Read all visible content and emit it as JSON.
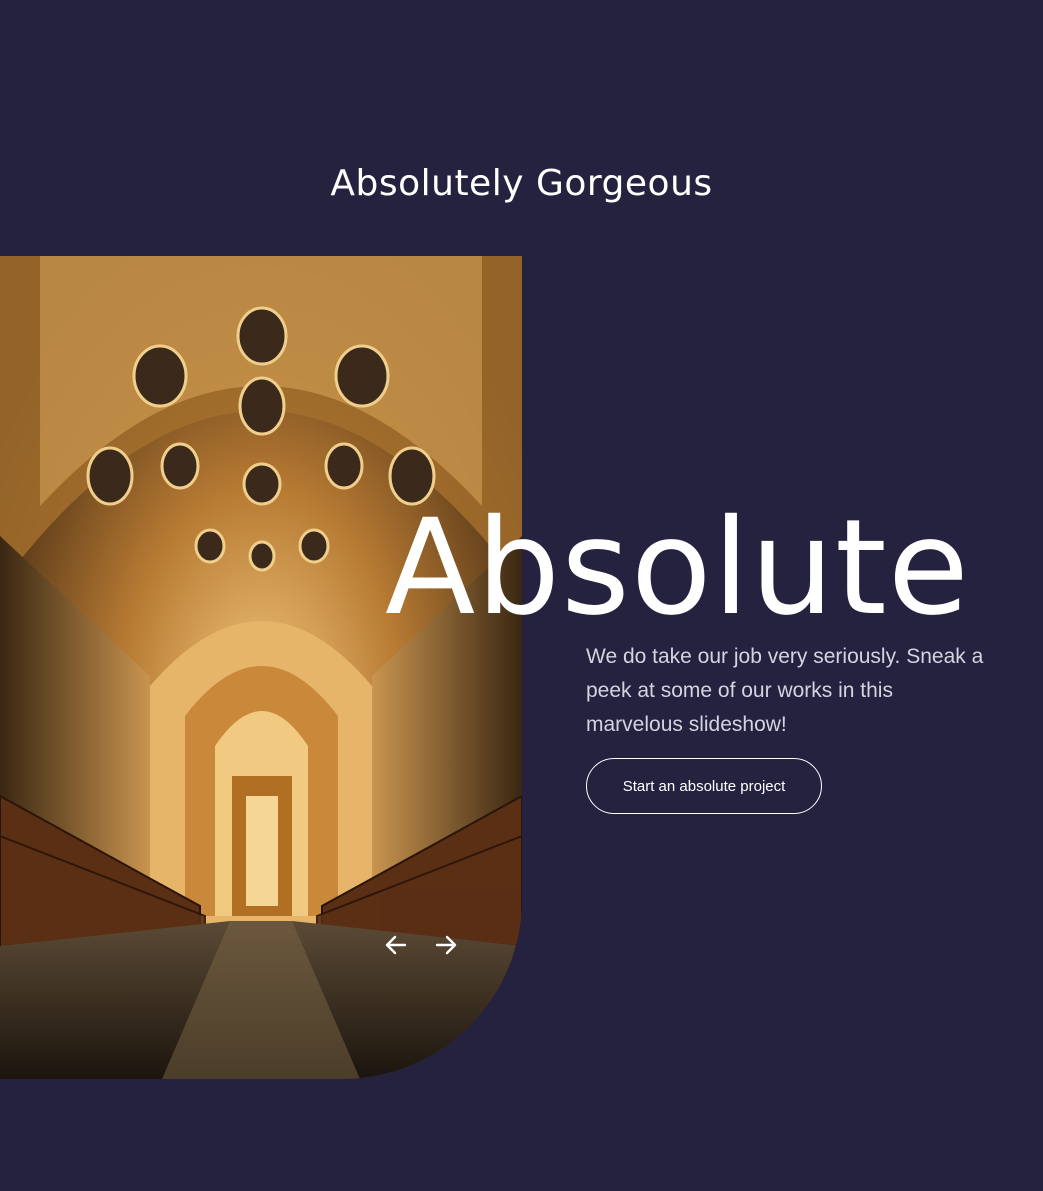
{
  "section": {
    "title": "Absolutely Gorgeous"
  },
  "slide": {
    "image_description_icon": "cathedral-interior-photo",
    "heading": "Absolute",
    "text": "We do take our job very seriously. Sneak a peek at some of our works in this marvelous slideshow!",
    "cta_label": "Start an absolute project"
  },
  "slider_controls": {
    "prev_icon": "arrow-left-icon",
    "next_icon": "arrow-right-icon"
  },
  "colors": {
    "background": "#252240",
    "text": "#ffffff",
    "muted_text": "#d4d3df",
    "image_gold": "#c98a3a"
  }
}
